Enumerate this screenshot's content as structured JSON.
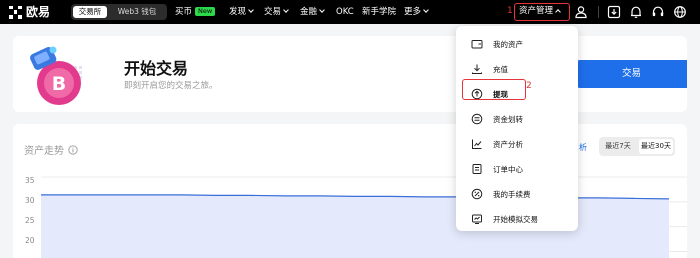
{
  "header": {
    "brand": "欧易",
    "segment": {
      "exchange": "交易所",
      "web3": "Web3 钱包"
    },
    "nav": {
      "buy": "买币",
      "buy_badge": "New",
      "discover": "发现",
      "trade": "交易",
      "finance": "金融",
      "okc": "OKC",
      "academy": "新手学院",
      "more": "更多"
    },
    "asset_management": "资产管理",
    "step1": "1"
  },
  "hero": {
    "title": "开始交易",
    "subtitle": "即刻开启您的交易之旅。",
    "trade_button": "交易"
  },
  "chart_panel": {
    "title": "资产走势",
    "analysis_link": "析",
    "ranges": [
      "最近7天",
      "最近30天"
    ],
    "selected_range": "最近30天",
    "y_ticks": [
      "35",
      "30",
      "25",
      "20"
    ]
  },
  "chart_data": {
    "type": "area",
    "series": [
      {
        "values": [
          31.4,
          31.4,
          31.4,
          31.4,
          31.4,
          31.3,
          31.3,
          31.2,
          31.2,
          31.1,
          31.1,
          31.0,
          31.0,
          30.9,
          30.9,
          30.8,
          30.8,
          30.7,
          30.6
        ]
      }
    ],
    "ylim": [
      17.5,
      36
    ],
    "color": "#3a6fd8",
    "fill": "#e4e9fb",
    "grid": true
  },
  "dropdown": {
    "items": [
      {
        "label": "我的资产",
        "icon": "wallet-icon"
      },
      {
        "label": "充值",
        "icon": "deposit-icon"
      },
      {
        "label": "提现",
        "icon": "withdraw-icon"
      },
      {
        "label": "资金划转",
        "icon": "transfer-icon"
      },
      {
        "label": "资产分析",
        "icon": "analysis-icon"
      },
      {
        "label": "订单中心",
        "icon": "order-icon"
      },
      {
        "label": "我的手续费",
        "icon": "fee-icon"
      },
      {
        "label": "开始模拟交易",
        "icon": "demo-trade-icon"
      }
    ],
    "step2": "2"
  },
  "colors": {
    "accent": "#1f6feb",
    "annotation": "#e5343a",
    "navbar": "#000000"
  }
}
